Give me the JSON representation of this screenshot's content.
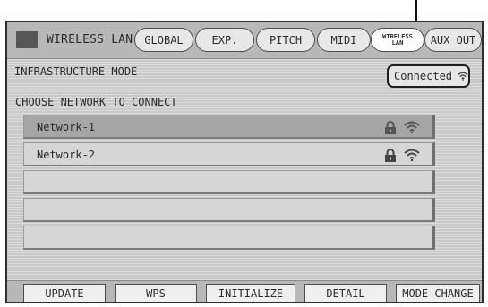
{
  "window": {
    "title": "WIRELESS LAN"
  },
  "tabs": [
    {
      "label": "GLOBAL"
    },
    {
      "label": "EXP."
    },
    {
      "label": "PITCH"
    },
    {
      "label": "MIDI"
    },
    {
      "line1": "WIRELESS",
      "line2": "LAN",
      "active": true
    },
    {
      "label": "AUX OUT"
    }
  ],
  "status": {
    "mode": "INFRASTRUCTURE MODE",
    "connection": "Connected"
  },
  "networks": {
    "heading": "CHOOSE NETWORK TO CONNECT",
    "items": [
      {
        "name": "Network-1",
        "locked": true,
        "selected": true
      },
      {
        "name": "Network-2",
        "locked": true,
        "selected": false
      },
      {
        "name": "",
        "locked": false
      },
      {
        "name": "",
        "locked": false
      },
      {
        "name": "",
        "locked": false
      }
    ]
  },
  "buttons": {
    "update": "UPDATE",
    "wps": "WPS",
    "initialize": "INITIALIZE",
    "detail": "DETAIL",
    "mode_change": "MODE CHANGE"
  },
  "icons": {
    "page": "wireless-lan-page-icon",
    "lock": "lock-icon",
    "signal": "wifi-signal-icon"
  },
  "colors": {
    "screen_bg": "#c9c9c9",
    "selected_row": "#a6a6a6",
    "row": "#d6d6d6",
    "page_icon": "#565656"
  }
}
